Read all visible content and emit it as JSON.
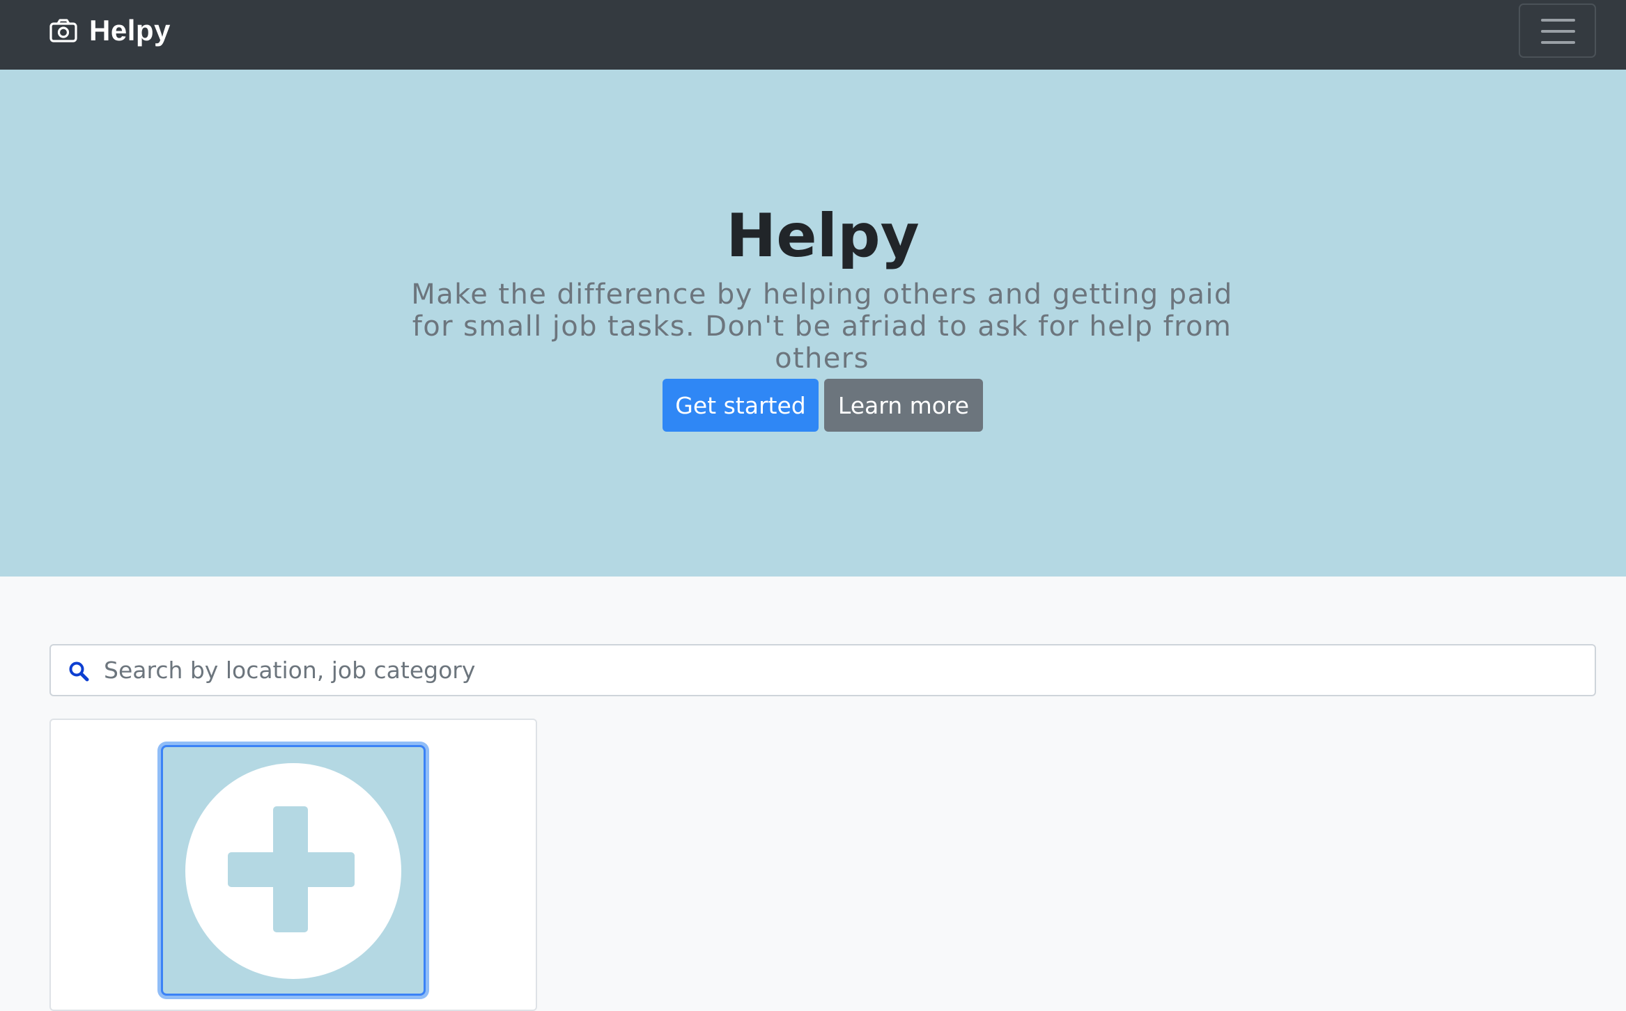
{
  "navbar": {
    "brand": "Helpy",
    "brand_icon": "camera-icon",
    "menu_icon": "hamburger-menu-icon"
  },
  "hero": {
    "title": "Helpy",
    "lead": "Make the difference by helping others and getting paid for small job tasks. Don't be afriad to ask for help from others",
    "primary_button": "Get started",
    "secondary_button": "Learn more"
  },
  "search": {
    "icon": "search-icon",
    "placeholder": "Search by location, job category",
    "value": ""
  },
  "card": {
    "icon": "add-circle-icon"
  },
  "colors": {
    "navbar_bg": "#343a40",
    "hero_bg": "#b4d8e3",
    "primary": "#2f87f5",
    "secondary": "#6c757d",
    "search_icon": "#0d3fd1"
  }
}
